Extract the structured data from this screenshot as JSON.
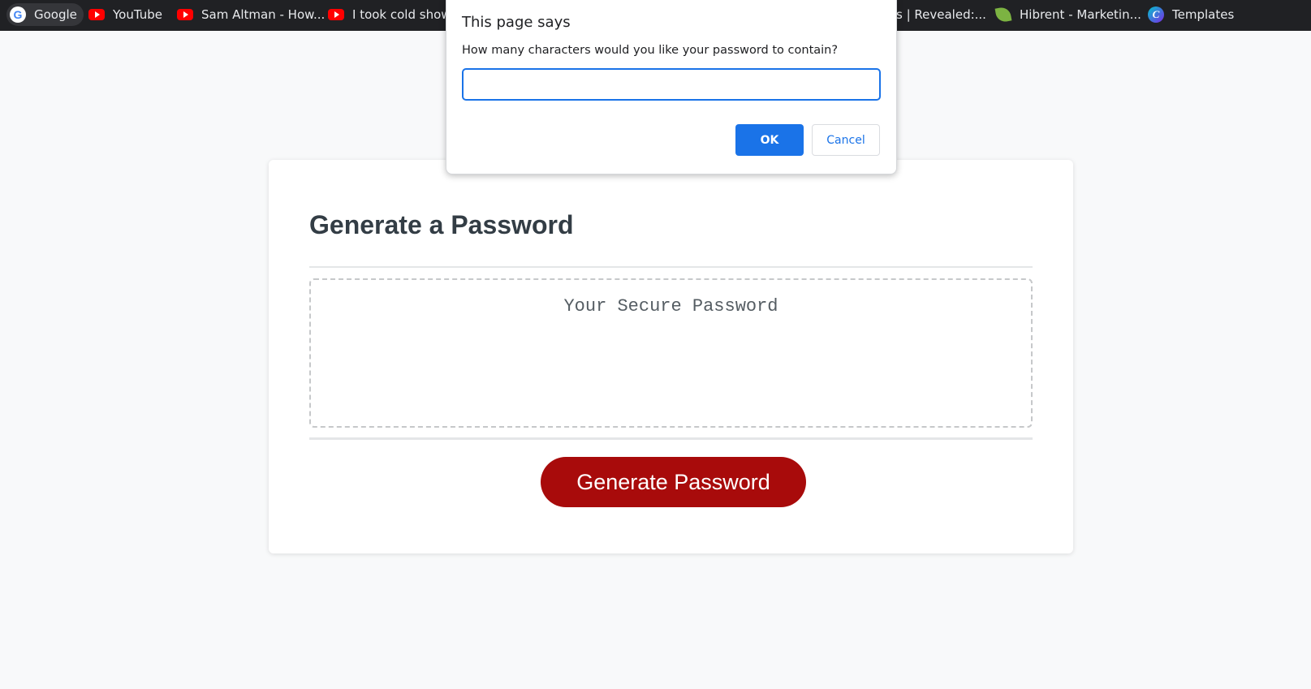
{
  "bookmarks": [
    {
      "label": "Google",
      "icon": "google-icon"
    },
    {
      "label": "YouTube",
      "icon": "youtube-icon"
    },
    {
      "label": "Sam Altman - How...",
      "icon": "youtube-icon"
    },
    {
      "label": "I took cold shower",
      "icon": "youtube-icon"
    },
    {
      "label": "s | Revealed:...",
      "icon": "none"
    },
    {
      "label": "Hibrent - Marketin...",
      "icon": "leaf-icon"
    },
    {
      "label": "Templates",
      "icon": "canva-icon"
    }
  ],
  "card": {
    "title": "Generate a Password",
    "password_placeholder": "Your Secure Password",
    "generate_button": "Generate Password"
  },
  "dialog": {
    "title": "This page says",
    "message": "How many characters would you like your password to contain?",
    "input_value": "",
    "ok_label": "OK",
    "cancel_label": "Cancel"
  },
  "colors": {
    "page_background": "#f8f9fa",
    "bookmarks_bar": "#202124",
    "title_text": "#333d45",
    "generate_button": "#a80b0b",
    "dialog_accent": "#1a73e8"
  }
}
